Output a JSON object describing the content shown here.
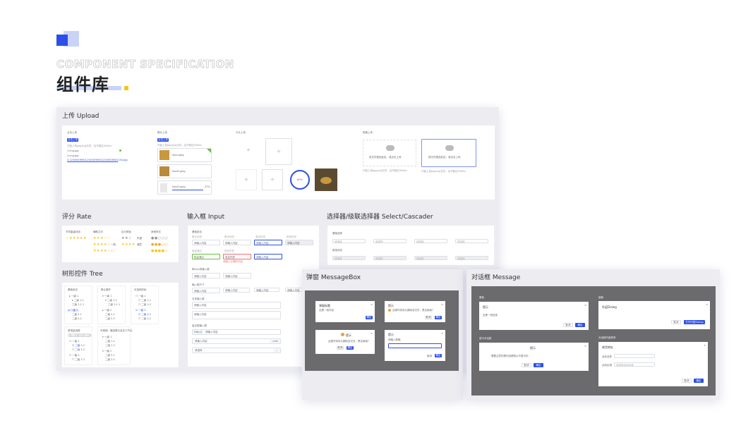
{
  "header": {
    "subtitle": "COMPONENT SPECIFICATION",
    "title": "组件库"
  },
  "sections": {
    "upload": "上传  Upload",
    "rate": "评分  Rate",
    "input": "输入框  Input",
    "select": "选择器/级联选择器 Select/Cascader",
    "tree": "树形控件 Tree",
    "messagebox": "弹窗  MessageBox",
    "message": "对话框  Message"
  },
  "upload": {
    "card1_title": "点击上传",
    "card1_btn": "点击上传",
    "card1_hint": "只能上传jpg/png文件，且不超过500kb",
    "card1_files": [
      "1.img.jpg",
      "2.img.jpg",
      "3.1234567890123456789012345678901234.jpg"
    ],
    "card2_title": "照片上传",
    "card2_btn": "点击上传",
    "card2_files": [
      "food.jpeg",
      "food2.jpeg",
      "food3.jpeg"
    ],
    "card2_progress": "47%",
    "card3_title": "卡片上传",
    "card3_progress": "60%",
    "card4_title": "拖拽上传",
    "card4_drag": "将文件拖到此处，或点击上传",
    "card4_hint": "只能上传jpg/png文件，且不超过500kb"
  },
  "rate": {
    "columns": [
      "不同星级状态",
      "辅助文字",
      "区分颜色",
      "其他样式"
    ],
    "aux_texts": [
      "失望",
      "一般",
      "满意"
    ],
    "score": "3.7"
  },
  "input": {
    "basic_label": "基础用法",
    "states": [
      "默认状态",
      "悬浮状态",
      "激活状态",
      "禁用状态"
    ],
    "placeholder": "请输入内容",
    "valid_label": "验证通过",
    "error_label": "验证失败",
    "error_msg": "请输入正确的内容",
    "icon_label": "带icon的输入框",
    "size_label": "输入框尺寸",
    "textarea_label": "文本输入框",
    "compound_label": "复合型输入框",
    "prefix": "Http://",
    "suffix": ".com"
  },
  "select": {
    "basic_label": "基础选择",
    "disabled_label": "禁用状态",
    "placeholder": "请选择"
  },
  "tree": {
    "titles": [
      "基础用法",
      "默认展开",
      "可选择的树",
      "禁用复选框",
      "可拖拽、懒加载与自定义节点"
    ],
    "node": "一级 1",
    "search_placeholder": "输入关键字进行过滤"
  },
  "messagebox": {
    "box1_title": "弹窗标题",
    "box1_text": "这是一段内容",
    "box2_title": "提示",
    "box2_text": "此操作将永久删除该文件，是否继续？",
    "box3_title": "提示",
    "box3_text": "此操作将永久删除该文件，是否继续？",
    "box4_title": "提示",
    "box4_text": "请输入邮箱",
    "cancel": "取消",
    "confirm": "确定"
  },
  "message": {
    "basic_label": "基础",
    "d1_title": "提示",
    "d1_text": "这是一段信息",
    "nested_label": "嵌套",
    "d2_title": "外层Dialog",
    "d2_btn": "打开内层Dialog",
    "center_label": "居中对话框",
    "d3_title": "提示",
    "d3_text": "需要注意的是内容是默认不居中的",
    "form_label": "对话框内嵌表单",
    "d4_title": "收货地址",
    "d4_field1": "活动名称",
    "d4_field2": "活动区域",
    "d4_select": "请选择活动区域",
    "cancel": "取消",
    "confirm": "确定"
  }
}
